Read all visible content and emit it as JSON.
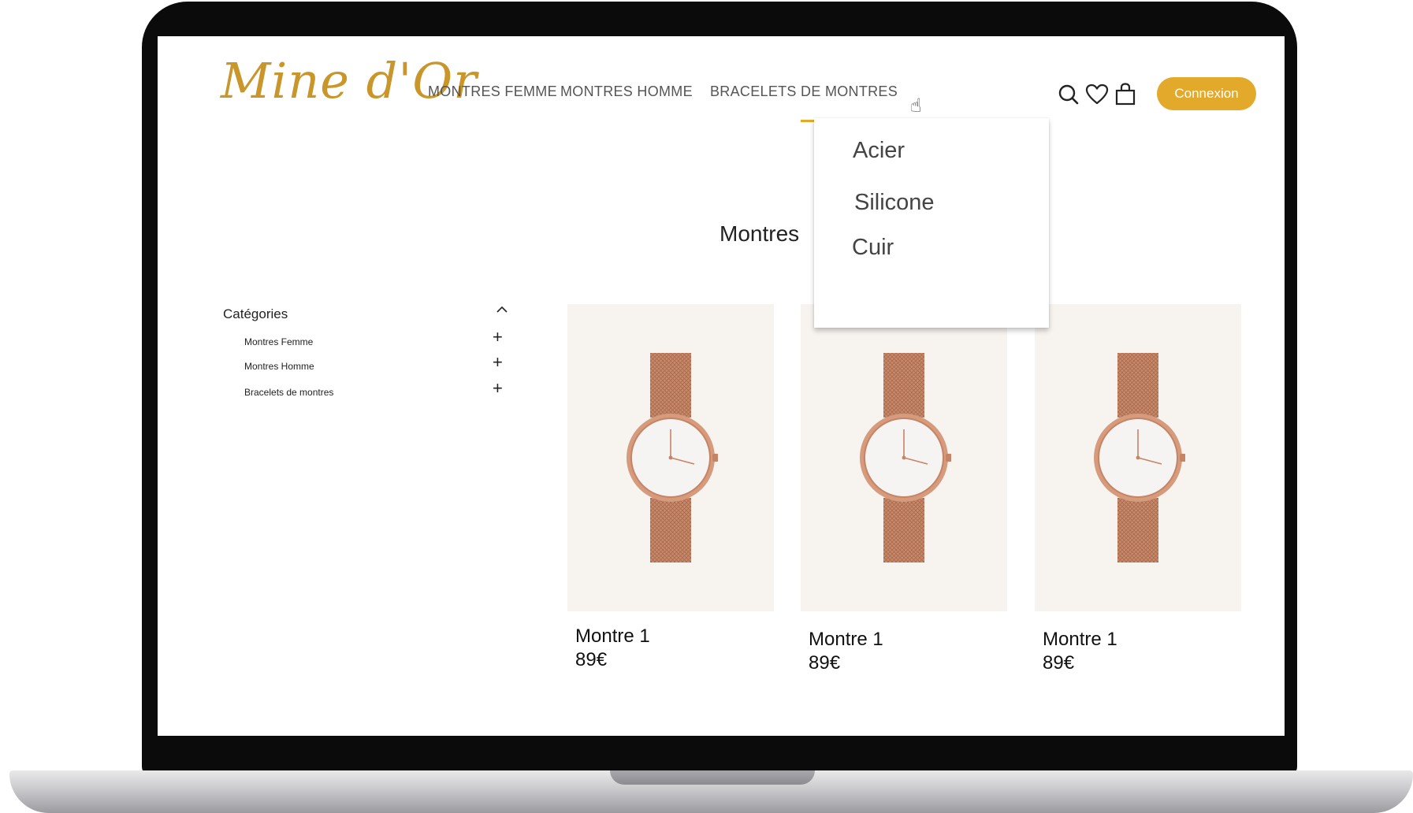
{
  "brand": {
    "logo_text": "Mine d'Or",
    "accent_color": "#e2a92b"
  },
  "nav": {
    "items": [
      {
        "label": "MONTRES FEMME"
      },
      {
        "label": "MONTRES HOMME"
      },
      {
        "label": "BRACELETS DE MONTRES"
      }
    ],
    "active_index": 2,
    "icons": [
      "search-icon",
      "heart-icon",
      "bag-icon"
    ],
    "login_label": "Connexion"
  },
  "dropdown": {
    "items": [
      {
        "label": "Acier"
      },
      {
        "label": "Silicone"
      },
      {
        "label": "Cuir"
      }
    ]
  },
  "page": {
    "title": "Montres"
  },
  "sidebar": {
    "title": "Catégories",
    "items": [
      {
        "label": "Montres Femme"
      },
      {
        "label": "Montres Homme"
      },
      {
        "label": "Bracelets de montres"
      }
    ]
  },
  "products": [
    {
      "name": "Montre 1",
      "price": "89€"
    },
    {
      "name": "Montre 1",
      "price": "89€"
    },
    {
      "name": "Montre 1",
      "price": "89€"
    }
  ]
}
